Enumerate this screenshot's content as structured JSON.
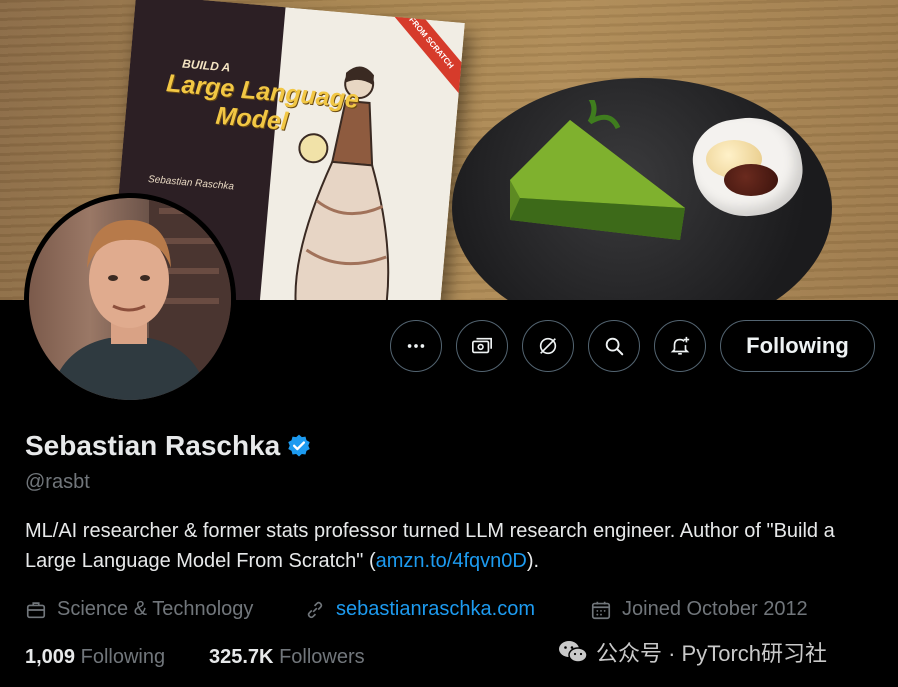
{
  "banner": {
    "book_small_text": "BUILD A",
    "book_title_line1": "Large Language",
    "book_title_line2": "Model",
    "book_author": "Sebastian Raschka",
    "book_ribbon": "FROM SCRATCH"
  },
  "actions": {
    "more_icon": "more-dots-icon",
    "subscribe_icon": "money-icon",
    "grok_icon": "grok-icon",
    "search_icon": "search-icon",
    "notify_icon": "bell-plus-icon",
    "follow_label": "Following"
  },
  "profile": {
    "name": "Sebastian Raschka",
    "handle": "@rasbt",
    "bio_text": "ML/AI researcher & former stats professor turned LLM research engineer. Author of \"Build a Large Language Model From Scratch\" (",
    "bio_link": "amzn.to/4fqvn0D",
    "bio_end": ").",
    "category": "Science & Technology",
    "website": "sebastianraschka.com",
    "joined": "Joined October 2012",
    "following_count": "1,009",
    "following_label": "Following",
    "followers_count": "325.7K",
    "followers_label": "Followers"
  },
  "watermark": {
    "text": "公众号 · PyTorch研习社"
  },
  "colors": {
    "accent": "#1d9bf0",
    "muted": "#71767b",
    "border": "#536471"
  }
}
